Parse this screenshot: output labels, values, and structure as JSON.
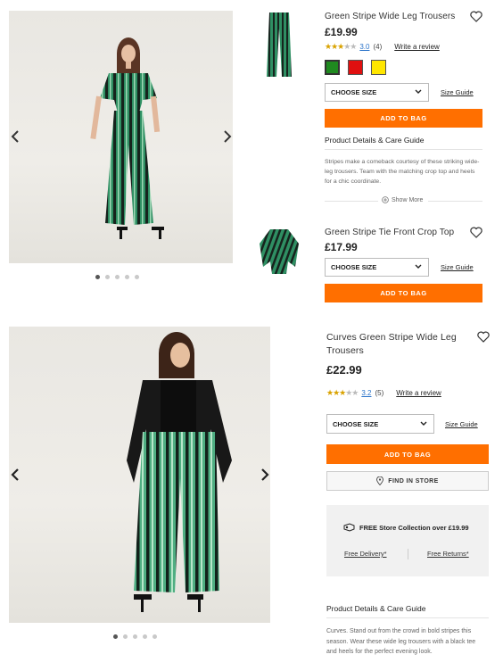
{
  "products": [
    {
      "name": "Green Stripe Wide Leg Trousers",
      "price": "£19.99",
      "rating_score": "3.0",
      "rating_count": "(4)",
      "rating_stars": 3,
      "write_review": "Write a review",
      "swatch_colors": [
        "#1f8a1f",
        "#e01010",
        "#ffe600"
      ],
      "size_placeholder": "CHOOSE SIZE",
      "size_guide": "Size Guide",
      "add_to_bag": "ADD TO BAG",
      "details_title": "Product Details & Care Guide",
      "description": "Stripes make a comeback courtesy of these striking wide-leg trousers. Team with the matching crop top and heels for a chic coordinate.",
      "show_more": "Show More"
    },
    {
      "name": "Green Stripe Tie Front Crop Top",
      "price": "£17.99",
      "size_placeholder": "CHOOSE SIZE",
      "size_guide": "Size Guide",
      "add_to_bag": "ADD TO BAG"
    },
    {
      "name_line1": "Curves Green Stripe Wide Leg",
      "name_line2": "Trousers",
      "price": "£22.99",
      "rating_score": "3.2",
      "rating_count": "(5)",
      "rating_stars": 3,
      "write_review": "Write a review",
      "size_placeholder": "CHOOSE SIZE",
      "size_guide": "Size Guide",
      "add_to_bag": "ADD TO BAG",
      "find_in_store": "FIND IN STORE",
      "promo_title": "FREE Store Collection over £19.99",
      "free_delivery": "Free Delivery*",
      "free_returns": "Free Returns*",
      "details_title": "Product Details & Care Guide",
      "description": "Curves. Stand out from the crowd in bold stripes this season. Wear these wide leg trousers with a black tee and heels for the perfect evening look."
    }
  ],
  "gallery_top": {
    "dot_count": 5,
    "active_dot": 1
  },
  "gallery_bottom": {
    "dot_count": 5,
    "active_dot": 1
  },
  "colors": {
    "accent": "#ff6f00",
    "link": "#2a73c9",
    "stripe_green": "#3a9a6a",
    "stripe_dark": "#1e2a24"
  }
}
